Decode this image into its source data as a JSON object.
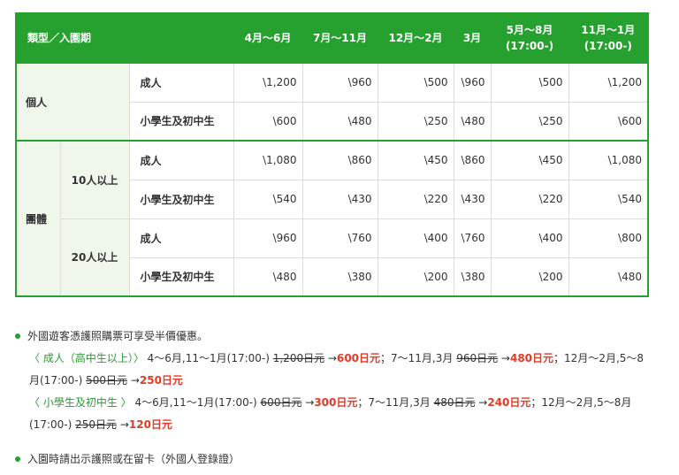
{
  "table": {
    "headers": {
      "type": "類型／入園期",
      "cols": [
        {
          "l1": "4月〜6月",
          "l2": ""
        },
        {
          "l1": "7月〜11月",
          "l2": ""
        },
        {
          "l1": "12月〜2月",
          "l2": ""
        },
        {
          "l1": "3月",
          "l2": ""
        },
        {
          "l1": "5月〜8月",
          "l2": "(17:00-)"
        },
        {
          "l1": "11月〜1月",
          "l2": "(17:00-)"
        }
      ]
    },
    "individual": {
      "label": "個人",
      "rows": [
        {
          "kind": "成人",
          "values": [
            "\\1,200",
            "\\960",
            "\\500",
            "\\960",
            "\\500",
            "\\1,200"
          ]
        },
        {
          "kind": "小學生及初中生",
          "values": [
            "\\600",
            "\\480",
            "\\250",
            "\\480",
            "\\250",
            "\\600"
          ]
        }
      ]
    },
    "group": {
      "label": "團體",
      "subgroups": [
        {
          "label": "10人以上",
          "rows": [
            {
              "kind": "成人",
              "values": [
                "\\1,080",
                "\\860",
                "\\450",
                "\\860",
                "\\450",
                "\\1,080"
              ]
            },
            {
              "kind": "小學生及初中生",
              "values": [
                "\\540",
                "\\430",
                "\\220",
                "\\430",
                "\\220",
                "\\540"
              ]
            }
          ]
        },
        {
          "label": "20人以上",
          "rows": [
            {
              "kind": "成人",
              "values": [
                "\\960",
                "\\760",
                "\\400",
                "\\760",
                "\\400",
                "\\800"
              ]
            },
            {
              "kind": "小學生及初中生",
              "values": [
                "\\480",
                "\\380",
                "\\200",
                "\\380",
                "\\200",
                "\\480"
              ]
            }
          ]
        }
      ]
    }
  },
  "notes": {
    "note1": "外國遊客憑護照購票可享受半價優惠。",
    "adult": {
      "label": "〈 成人（高中生以上）〉",
      "p1_period": " 4〜6月,11〜1月(17:00-) ",
      "p1_old": "1,200日元",
      "p1_new": "600日元",
      "p2_period": "；7〜11月,3月 ",
      "p2_old": "960日元",
      "p2_new": "480日元",
      "p3_period": "；12月〜2月,5〜8月(17:00-) ",
      "p3_old": "500日元",
      "p3_new": "250日元"
    },
    "child": {
      "label": "〈 小學生及初中生 〉",
      "p1_period": " 4〜6月,11〜1月(17:00-) ",
      "p1_old": "600日元",
      "p1_new": "300日元",
      "p2_period": "；7〜11月,3月 ",
      "p2_old": "480日元",
      "p2_new": "240日元",
      "p3_period": "；12月〜2月,5〜8月(17:00-) ",
      "p3_old": "250日元",
      "p3_new": "120日元"
    },
    "arrow": " →",
    "note2": "入園時請出示護照或在留卡（外國人登錄證）"
  },
  "colors": {
    "accent": "#26a02e",
    "discount": "#e23a24",
    "label_bg": "#eef7ea"
  }
}
